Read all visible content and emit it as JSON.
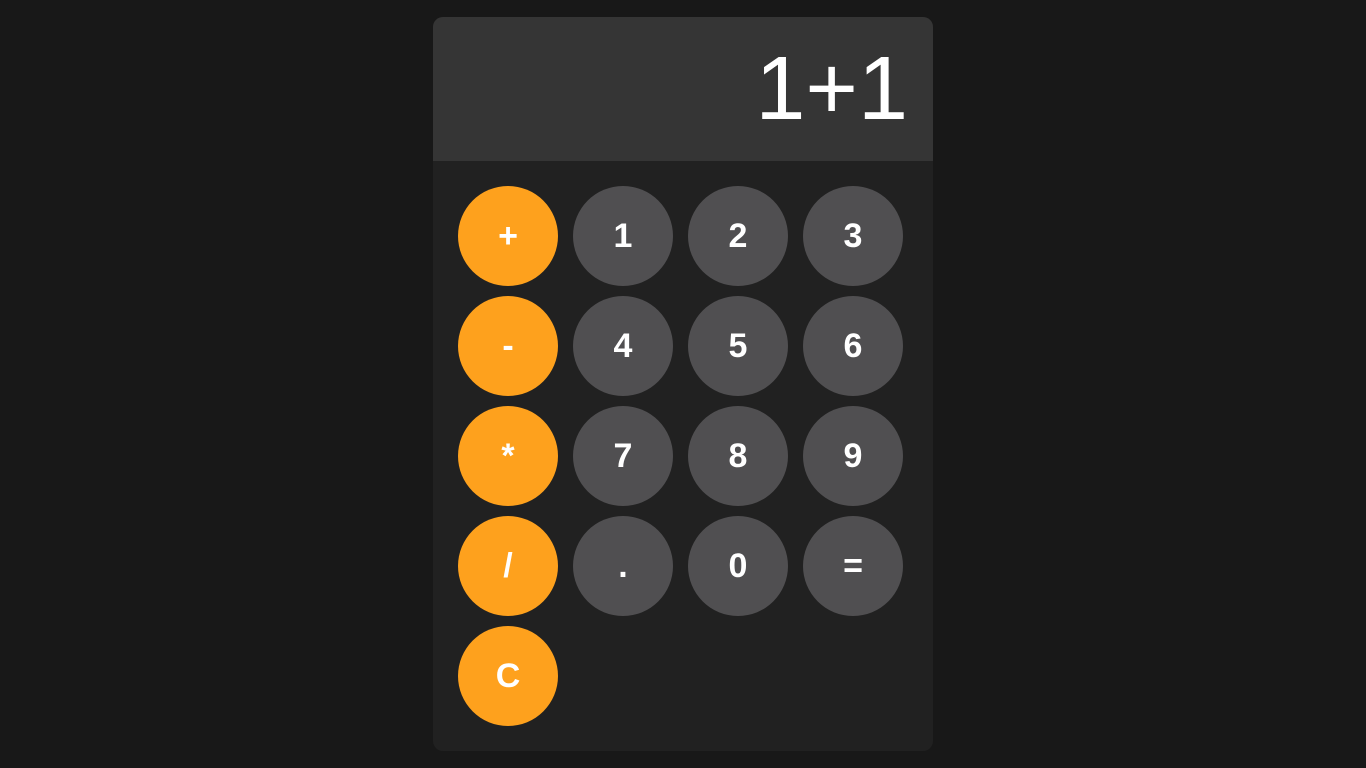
{
  "display": {
    "value": "1+1"
  },
  "colors": {
    "page_background": "#181818",
    "calculator_body": "#212121",
    "display_background": "#353535",
    "operator_key": "#fea11d",
    "number_key": "#504f51",
    "key_text": "#ffffff"
  },
  "keys": {
    "add": "+",
    "one": "1",
    "two": "2",
    "three": "3",
    "subtract": "-",
    "four": "4",
    "five": "5",
    "six": "6",
    "multiply": "*",
    "seven": "7",
    "eight": "8",
    "nine": "9",
    "divide": "/",
    "decimal": ".",
    "zero": "0",
    "equals": "=",
    "clear": "C"
  }
}
